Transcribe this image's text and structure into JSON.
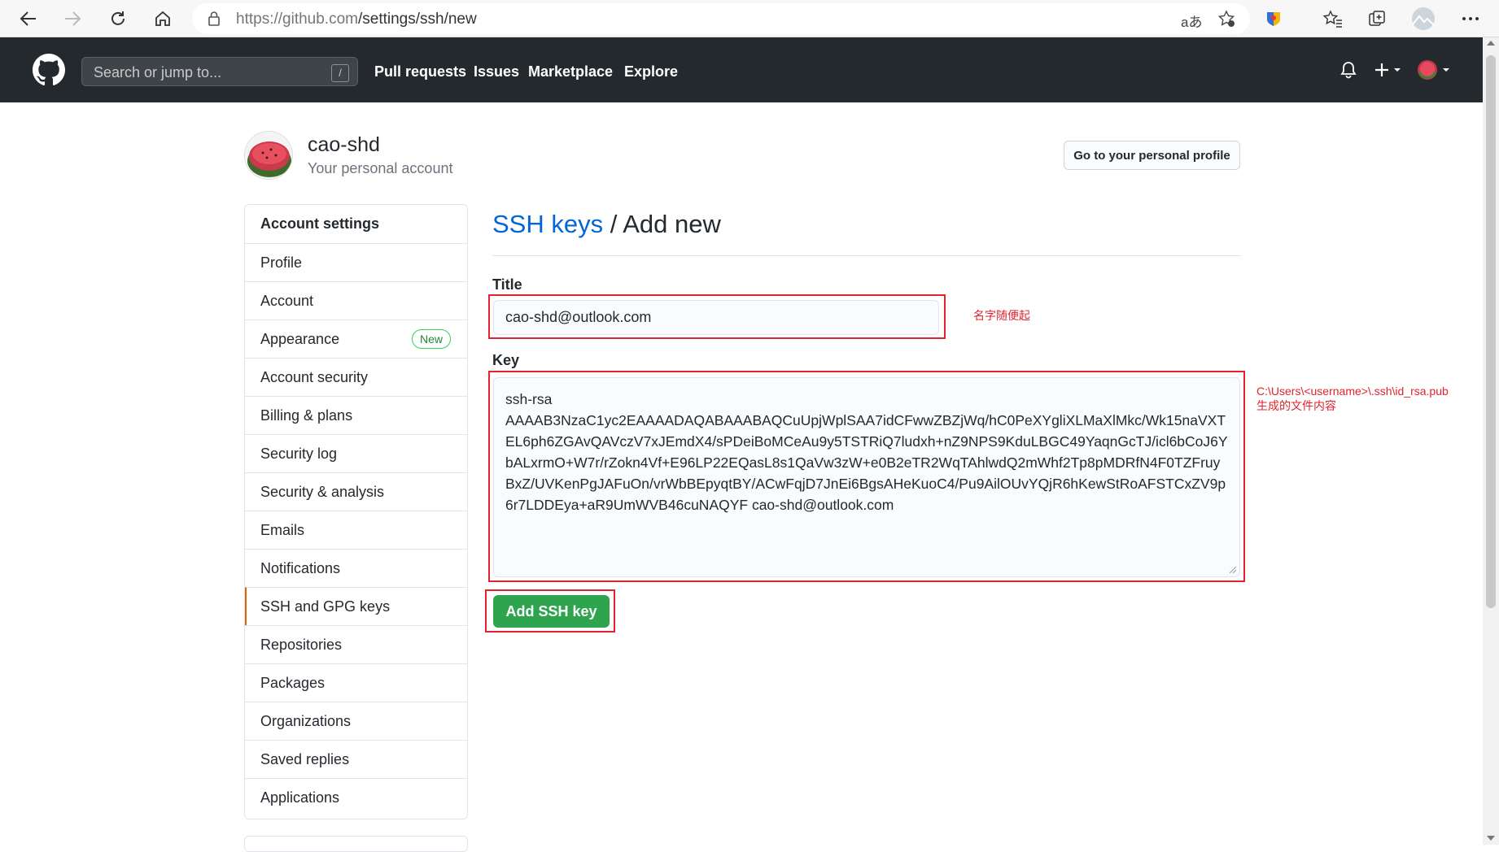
{
  "browser": {
    "url": "https://github.com/settings/ssh/new",
    "url_host": "https://github.com",
    "url_path": "/settings/ssh/new"
  },
  "header": {
    "search_placeholder": "Search or jump to...",
    "search_shortcut": "/",
    "nav": [
      "Pull requests",
      "Issues",
      "Marketplace",
      "Explore"
    ]
  },
  "profile": {
    "username": "cao-shd",
    "subtitle": "Your personal account",
    "profile_button": "Go to your personal profile"
  },
  "sidebar": {
    "items": [
      {
        "label": "Account settings"
      },
      {
        "label": "Profile"
      },
      {
        "label": "Account"
      },
      {
        "label": "Appearance",
        "badge": "New"
      },
      {
        "label": "Account security"
      },
      {
        "label": "Billing & plans"
      },
      {
        "label": "Security log"
      },
      {
        "label": "Security & analysis"
      },
      {
        "label": "Emails"
      },
      {
        "label": "Notifications"
      },
      {
        "label": "SSH and GPG keys",
        "selected": true
      },
      {
        "label": "Repositories"
      },
      {
        "label": "Packages"
      },
      {
        "label": "Organizations"
      },
      {
        "label": "Saved replies"
      },
      {
        "label": "Applications"
      }
    ]
  },
  "main": {
    "title_link": "SSH keys",
    "title_rest": "/ Add new",
    "title_label": "Title",
    "title_value": "cao-shd@outlook.com",
    "key_label": "Key",
    "key_value": "ssh-rsa\nAAAAB3NzaC1yc2EAAAADAQABAAABAQCuUpjWplSAA7idCFwwZBZjWq/hC0PeXYgliXLMaXlMkc/Wk15naVXTEL6ph6ZGAvQAVczV7xJEmdX4/sPDeiBoMCeAu9y5TSTRiQ7ludxh+nZ9NPS9KduLBGC49YaqnGcTJ/icl6bCoJ6YbALxrmO+W7r/rZokn4Vf+E96LP22EQasL8s1QaVw3zW+e0B2eTR2WqTAhlwdQ2mWhf2Tp8pMDRfN4F0TZFruyBxZ/UVKenPgJAFuOn/vrWbBEpyqtBY/ACwFqjD7JnEi6BgsAHeKuoC4/Pu9AilOUvYQjR6hKewStRoAFSTCxZV9p6r7LDDEya+aR9UmWVB46cuNAQYF cao-shd@outlook.com",
    "add_button": "Add SSH key"
  },
  "annotations": {
    "title_note": "名字随便起",
    "key_note_line1": "C:\\Users\\<username>\\.ssh\\id_rsa.pub",
    "key_note_line2": "生成的文件内容"
  },
  "colors": {
    "header_bg": "#24292e",
    "link": "#0366d6",
    "primary_button": "#2ea44f",
    "annotation_red": "#e0232e",
    "selected_accent": "#e36209"
  },
  "icons": [
    "back-arrow-icon",
    "forward-arrow-icon",
    "refresh-icon",
    "home-icon",
    "lock-icon",
    "translate-icon",
    "favorite-add-icon",
    "extension-icon",
    "favorites-icon",
    "collections-icon",
    "browser-profile-icon",
    "more-icon",
    "github-logo-icon",
    "bell-icon",
    "plus-icon",
    "user-avatar-icon"
  ]
}
